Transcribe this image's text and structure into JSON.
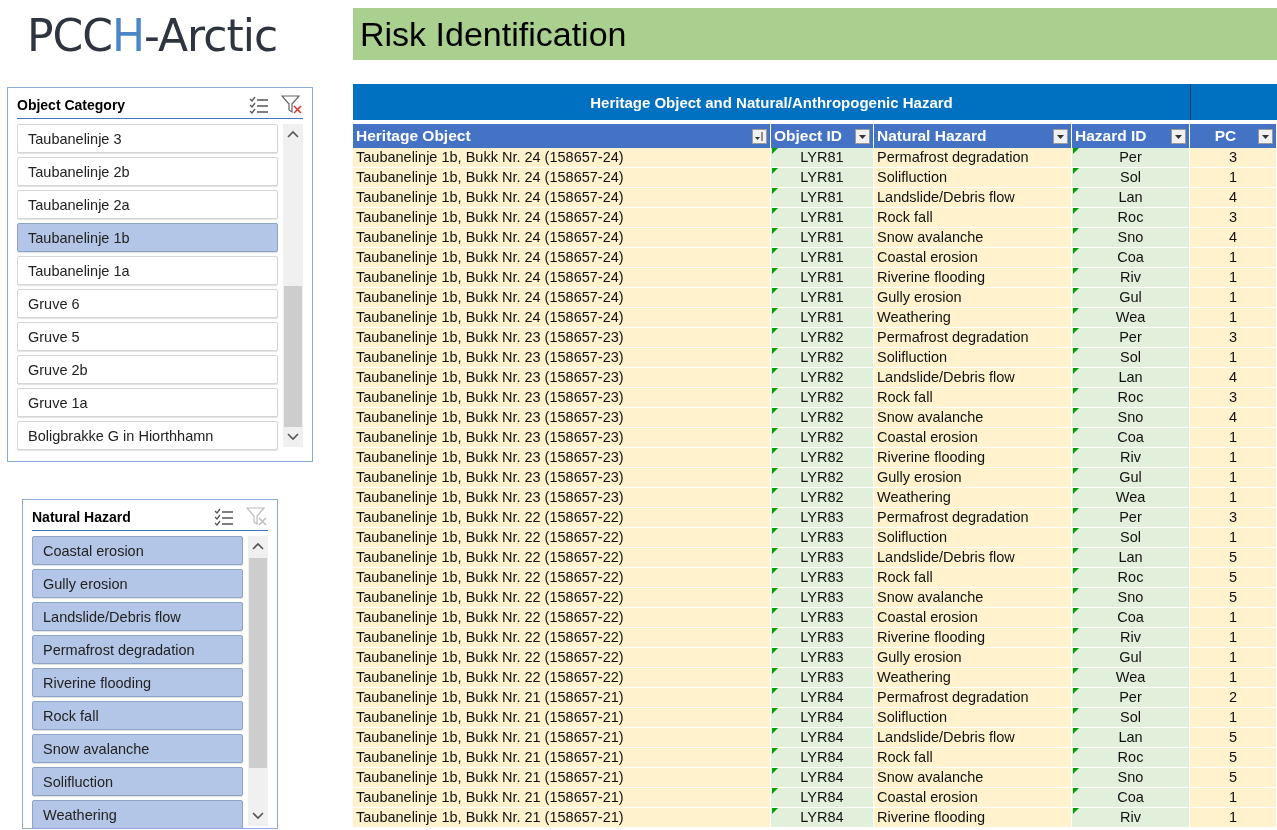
{
  "logo": {
    "parts": [
      {
        "text": "PCC",
        "accent": false
      },
      {
        "text": "H",
        "accent": true
      },
      {
        "text": "-Arctic",
        "accent": false
      }
    ]
  },
  "title": "Risk Identification",
  "slicers": [
    {
      "title": "Object Category",
      "clear_filter_enabled": true,
      "items": [
        {
          "label": "Taubanelinje 3",
          "selected": false
        },
        {
          "label": "Taubanelinje 2b",
          "selected": false
        },
        {
          "label": "Taubanelinje 2a",
          "selected": false
        },
        {
          "label": "Taubanelinje 1b",
          "selected": true
        },
        {
          "label": "Taubanelinje 1a",
          "selected": false
        },
        {
          "label": "Gruve 6",
          "selected": false
        },
        {
          "label": "Gruve 5",
          "selected": false
        },
        {
          "label": "Gruve 2b",
          "selected": false
        },
        {
          "label": "Gruve 1a",
          "selected": false
        },
        {
          "label": "Boligbrakke G in Hiorthhamn",
          "selected": false
        }
      ]
    },
    {
      "title": "Natural Hazard",
      "clear_filter_enabled": false,
      "items": [
        {
          "label": "Coastal erosion",
          "selected": true
        },
        {
          "label": "Gully erosion",
          "selected": true
        },
        {
          "label": "Landslide/Debris flow",
          "selected": true
        },
        {
          "label": "Permafrost degradation",
          "selected": true
        },
        {
          "label": "Riverine flooding",
          "selected": true
        },
        {
          "label": "Rock fall",
          "selected": true
        },
        {
          "label": "Snow avalanche",
          "selected": true
        },
        {
          "label": "Solifluction",
          "selected": true
        },
        {
          "label": "Weathering",
          "selected": true
        }
      ]
    }
  ],
  "table": {
    "group_header": "Heritage Object and Natural/Anthropogenic Hazard",
    "columns": [
      {
        "label": "Heritage Object",
        "sorted": true
      },
      {
        "label": "Object ID",
        "sorted": false
      },
      {
        "label": "Natural Hazard",
        "sorted": false
      },
      {
        "label": "Hazard ID",
        "sorted": false
      },
      {
        "label": "PC",
        "sorted": false
      }
    ],
    "rows": [
      [
        "Taubanelinje 1b, Bukk Nr. 24 (158657-24)",
        "LYR81",
        "Permafrost degradation",
        "Per",
        "3"
      ],
      [
        "Taubanelinje 1b, Bukk Nr. 24 (158657-24)",
        "LYR81",
        "Solifluction",
        "Sol",
        "1"
      ],
      [
        "Taubanelinje 1b, Bukk Nr. 24 (158657-24)",
        "LYR81",
        "Landslide/Debris flow",
        "Lan",
        "4"
      ],
      [
        "Taubanelinje 1b, Bukk Nr. 24 (158657-24)",
        "LYR81",
        "Rock fall",
        "Roc",
        "3"
      ],
      [
        "Taubanelinje 1b, Bukk Nr. 24 (158657-24)",
        "LYR81",
        "Snow avalanche",
        "Sno",
        "4"
      ],
      [
        "Taubanelinje 1b, Bukk Nr. 24 (158657-24)",
        "LYR81",
        "Coastal erosion",
        "Coa",
        "1"
      ],
      [
        "Taubanelinje 1b, Bukk Nr. 24 (158657-24)",
        "LYR81",
        "Riverine flooding",
        "Riv",
        "1"
      ],
      [
        "Taubanelinje 1b, Bukk Nr. 24 (158657-24)",
        "LYR81",
        "Gully erosion",
        "Gul",
        "1"
      ],
      [
        "Taubanelinje 1b, Bukk Nr. 24 (158657-24)",
        "LYR81",
        "Weathering",
        "Wea",
        "1"
      ],
      [
        "Taubanelinje 1b, Bukk Nr. 23 (158657-23)",
        "LYR82",
        "Permafrost degradation",
        "Per",
        "3"
      ],
      [
        "Taubanelinje 1b, Bukk Nr. 23 (158657-23)",
        "LYR82",
        "Solifluction",
        "Sol",
        "1"
      ],
      [
        "Taubanelinje 1b, Bukk Nr. 23 (158657-23)",
        "LYR82",
        "Landslide/Debris flow",
        "Lan",
        "4"
      ],
      [
        "Taubanelinje 1b, Bukk Nr. 23 (158657-23)",
        "LYR82",
        "Rock fall",
        "Roc",
        "3"
      ],
      [
        "Taubanelinje 1b, Bukk Nr. 23 (158657-23)",
        "LYR82",
        "Snow avalanche",
        "Sno",
        "4"
      ],
      [
        "Taubanelinje 1b, Bukk Nr. 23 (158657-23)",
        "LYR82",
        "Coastal erosion",
        "Coa",
        "1"
      ],
      [
        "Taubanelinje 1b, Bukk Nr. 23 (158657-23)",
        "LYR82",
        "Riverine flooding",
        "Riv",
        "1"
      ],
      [
        "Taubanelinje 1b, Bukk Nr. 23 (158657-23)",
        "LYR82",
        "Gully erosion",
        "Gul",
        "1"
      ],
      [
        "Taubanelinje 1b, Bukk Nr. 23 (158657-23)",
        "LYR82",
        "Weathering",
        "Wea",
        "1"
      ],
      [
        "Taubanelinje 1b, Bukk Nr. 22 (158657-22)",
        "LYR83",
        "Permafrost degradation",
        "Per",
        "3"
      ],
      [
        "Taubanelinje 1b, Bukk Nr. 22 (158657-22)",
        "LYR83",
        "Solifluction",
        "Sol",
        "1"
      ],
      [
        "Taubanelinje 1b, Bukk Nr. 22 (158657-22)",
        "LYR83",
        "Landslide/Debris flow",
        "Lan",
        "5"
      ],
      [
        "Taubanelinje 1b, Bukk Nr. 22 (158657-22)",
        "LYR83",
        "Rock fall",
        "Roc",
        "5"
      ],
      [
        "Taubanelinje 1b, Bukk Nr. 22 (158657-22)",
        "LYR83",
        "Snow avalanche",
        "Sno",
        "5"
      ],
      [
        "Taubanelinje 1b, Bukk Nr. 22 (158657-22)",
        "LYR83",
        "Coastal erosion",
        "Coa",
        "1"
      ],
      [
        "Taubanelinje 1b, Bukk Nr. 22 (158657-22)",
        "LYR83",
        "Riverine flooding",
        "Riv",
        "1"
      ],
      [
        "Taubanelinje 1b, Bukk Nr. 22 (158657-22)",
        "LYR83",
        "Gully erosion",
        "Gul",
        "1"
      ],
      [
        "Taubanelinje 1b, Bukk Nr. 22 (158657-22)",
        "LYR83",
        "Weathering",
        "Wea",
        "1"
      ],
      [
        "Taubanelinje 1b, Bukk Nr. 21 (158657-21)",
        "LYR84",
        "Permafrost degradation",
        "Per",
        "2"
      ],
      [
        "Taubanelinje 1b, Bukk Nr. 21 (158657-21)",
        "LYR84",
        "Solifluction",
        "Sol",
        "1"
      ],
      [
        "Taubanelinje 1b, Bukk Nr. 21 (158657-21)",
        "LYR84",
        "Landslide/Debris flow",
        "Lan",
        "5"
      ],
      [
        "Taubanelinje 1b, Bukk Nr. 21 (158657-21)",
        "LYR84",
        "Rock fall",
        "Roc",
        "5"
      ],
      [
        "Taubanelinje 1b, Bukk Nr. 21 (158657-21)",
        "LYR84",
        "Snow avalanche",
        "Sno",
        "5"
      ],
      [
        "Taubanelinje 1b, Bukk Nr. 21 (158657-21)",
        "LYR84",
        "Coastal erosion",
        "Coa",
        "1"
      ],
      [
        "Taubanelinje 1b, Bukk Nr. 21 (158657-21)",
        "LYR84",
        "Riverine flooding",
        "Riv",
        "1"
      ]
    ]
  }
}
